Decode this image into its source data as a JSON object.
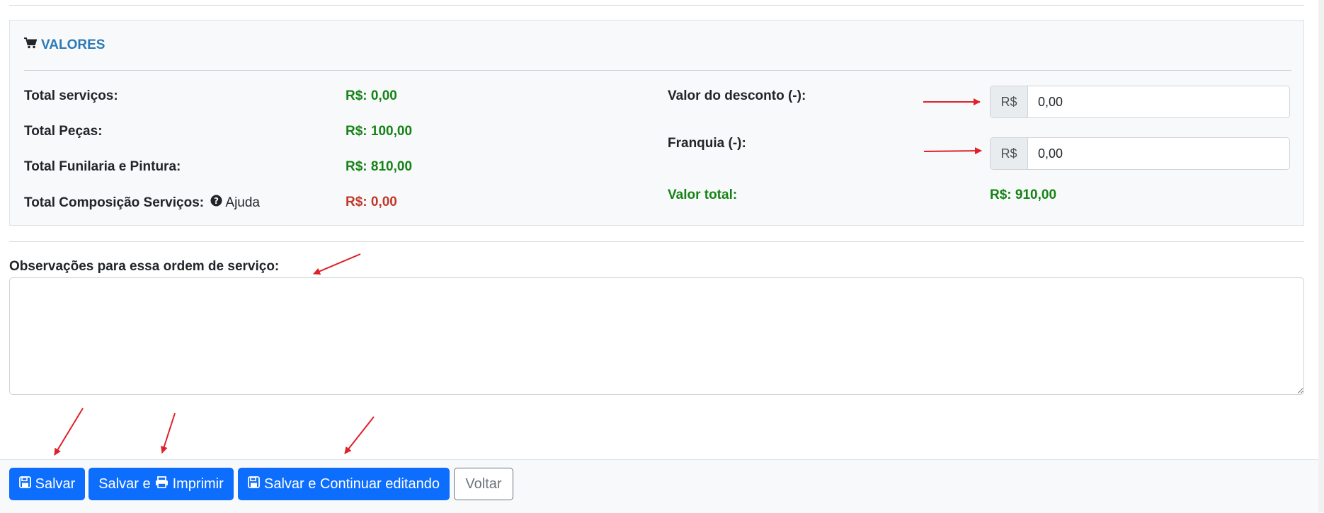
{
  "valores": {
    "title": "VALORES",
    "total_servicos_label": "Total serviços:",
    "total_servicos_value": "R$: 0,00",
    "total_pecas_label": "Total Peças:",
    "total_pecas_value": "R$: 100,00",
    "total_funilaria_label": "Total Funilaria e Pintura:",
    "total_funilaria_value": "R$: 810,00",
    "total_composicao_label": "Total Composição Serviços:",
    "help_label": "Ajuda",
    "total_composicao_value": "R$: 0,00",
    "desconto_label": "Valor do desconto (-):",
    "desconto_prefix": "R$",
    "desconto_value": "0,00",
    "franquia_label": "Franquia (-):",
    "franquia_prefix": "R$",
    "franquia_value": "0,00",
    "valor_total_label": "Valor total:",
    "valor_total_value": "R$: 910,00"
  },
  "observacoes": {
    "label": "Observações para essa ordem de serviço:",
    "value": ""
  },
  "footer": {
    "save_label": "Salvar",
    "save_print_prefix": "Salvar e",
    "save_print_suffix": "Imprimir",
    "save_continue_label": "Salvar e Continuar editando",
    "back_label": "Voltar"
  },
  "colors": {
    "accent": "#2a7ab8",
    "positive": "#168316",
    "negative": "#c0392b",
    "primary_button": "#0d6efd",
    "annotation_arrow": "#e0202a"
  },
  "icons": [
    "shopping-cart-icon",
    "question-circle-icon",
    "floppy-disk-icon",
    "printer-icon",
    "resize-handle-icon"
  ]
}
